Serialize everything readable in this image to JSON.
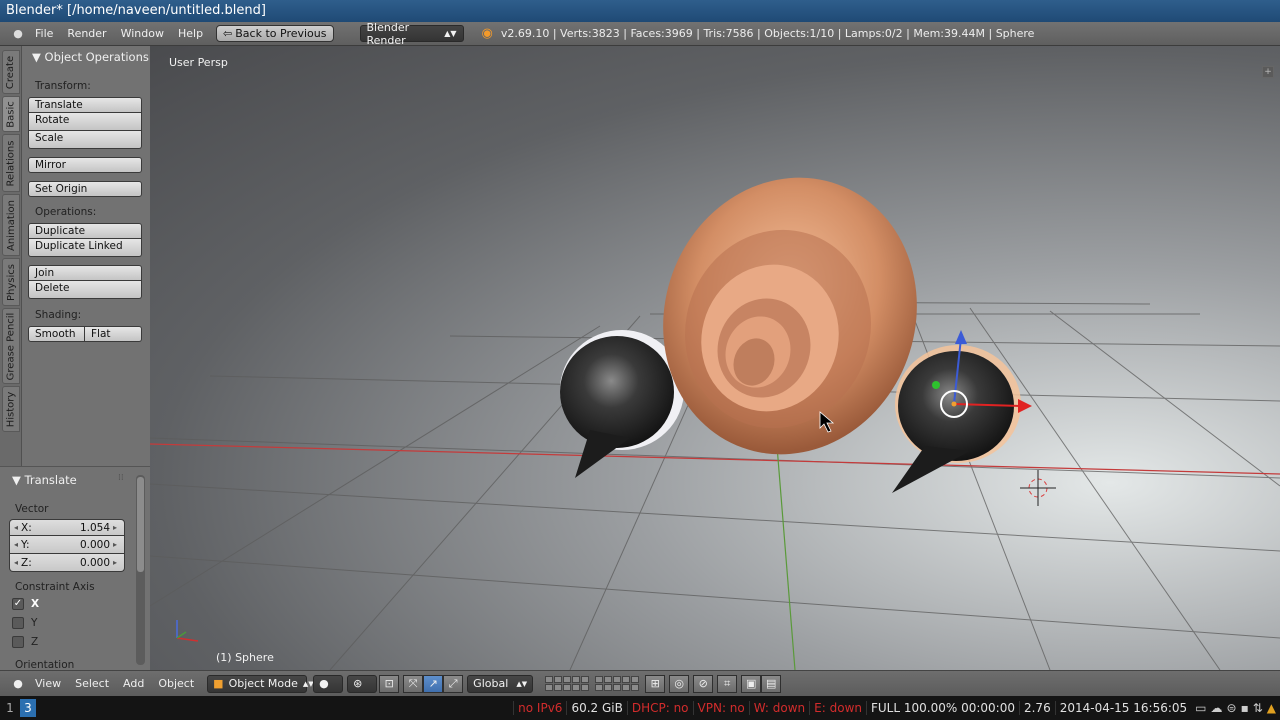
{
  "window": {
    "title": "Blender* [/home/naveen/untitled.blend]"
  },
  "info_header": {
    "menus": [
      "File",
      "Render",
      "Window",
      "Help"
    ],
    "back_button": "Back to Previous",
    "render_engine": "Blender Render",
    "stats": "v2.69.10 | Verts:3823 | Faces:3969 | Tris:7586 | Objects:1/10 | Lamps:0/2 | Mem:39.44M | Sphere"
  },
  "tool_tabs": [
    "Create",
    "Basic",
    "Relations",
    "Animation",
    "Physics",
    "Grease Pencil",
    "History"
  ],
  "tool_shelf": {
    "panel_title": "Object Operations",
    "transform_label": "Transform:",
    "translate": "Translate",
    "rotate": "Rotate",
    "scale": "Scale",
    "mirror": "Mirror",
    "set_origin": "Set Origin",
    "operations_label": "Operations:",
    "duplicate": "Duplicate",
    "duplicate_linked": "Duplicate Linked",
    "join": "Join",
    "delete": "Delete",
    "shading_label": "Shading:",
    "smooth": "Smooth",
    "flat": "Flat"
  },
  "operator_panel": {
    "title": "Translate",
    "vector_label": "Vector",
    "x_name": "X:",
    "x_value": "1.054",
    "y_name": "Y:",
    "y_value": "0.000",
    "z_name": "Z:",
    "z_value": "0.000",
    "constraint_label": "Constraint Axis",
    "axes": [
      {
        "label": "X",
        "checked": true
      },
      {
        "label": "Y",
        "checked": false
      },
      {
        "label": "Z",
        "checked": false
      }
    ],
    "orientation_label": "Orientation"
  },
  "viewport": {
    "view_label": "User Persp",
    "object_label": "(1) Sphere",
    "colors": {
      "ear": "#d8946b",
      "eye": "#2a2a2a",
      "x_axis": "#c43b3b",
      "y_axis": "#5a9a3a"
    }
  },
  "view3d_header": {
    "menus": [
      "View",
      "Select",
      "Add",
      "Object"
    ],
    "mode": "Object Mode",
    "orientation": "Global"
  },
  "taskbar": {
    "workspaces": [
      "1",
      "3"
    ],
    "ipv6": "no IPv6",
    "disk": "60.2 GiB",
    "dhcp": "DHCP: no",
    "vpn": "VPN: no",
    "wifi": "W: down",
    "ethernet": "E: down",
    "battery": "FULL 100.00% 00:00:00",
    "load": "2.76",
    "datetime": "2014-04-15 16:56:05"
  }
}
